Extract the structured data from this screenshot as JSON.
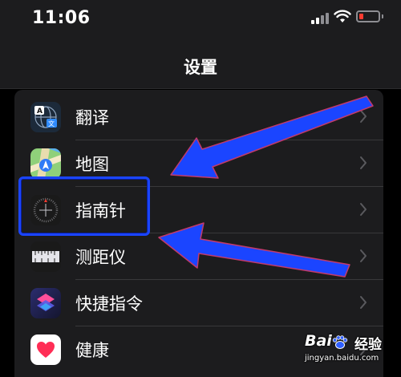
{
  "status_bar": {
    "time": "11:06"
  },
  "nav": {
    "title": "设置"
  },
  "settings_list": [
    {
      "label": "翻译",
      "icon": "translate-icon"
    },
    {
      "label": "地图",
      "icon": "maps-icon"
    },
    {
      "label": "指南针",
      "icon": "compass-icon"
    },
    {
      "label": "测距仪",
      "icon": "measure-icon"
    },
    {
      "label": "快捷指令",
      "icon": "shortcuts-icon"
    },
    {
      "label": "健康",
      "icon": "health-icon"
    }
  ],
  "watermark": {
    "brand": "Bai",
    "jingyan": "经验",
    "url": "jingyan.baidu.com"
  },
  "colors": {
    "annotation_blue": "#1b45ff",
    "battery_low": "#ff3b30",
    "shortcuts_start": "#5a5ce6",
    "health_heart": "#ff2d55"
  }
}
